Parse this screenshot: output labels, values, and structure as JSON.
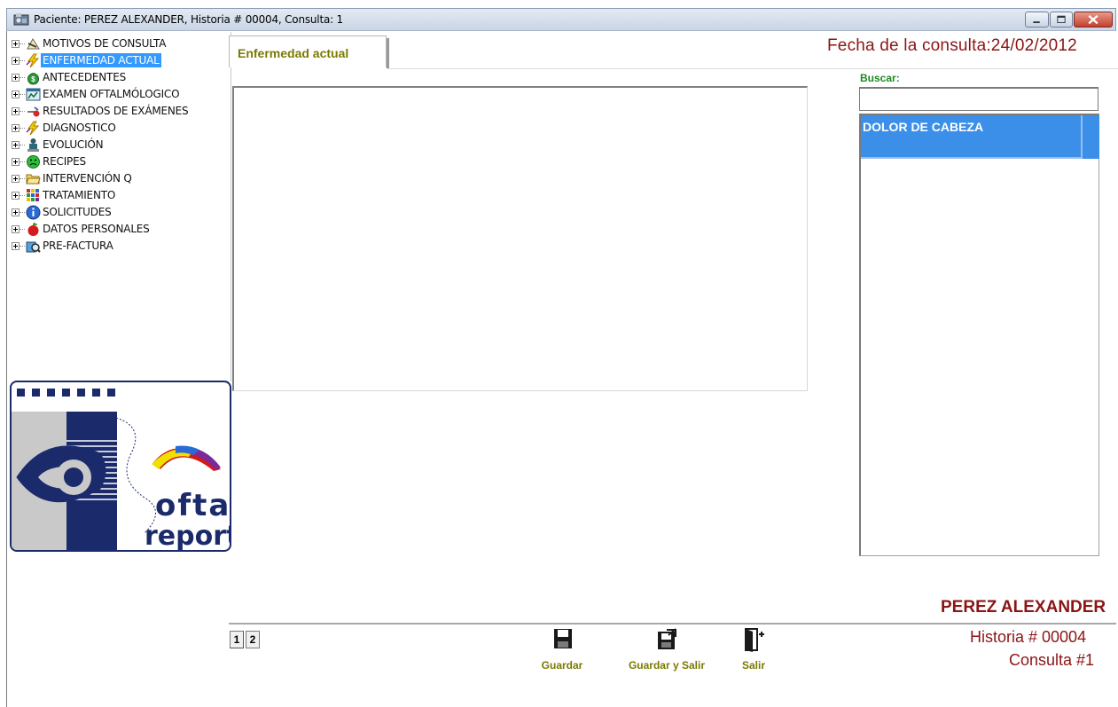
{
  "window": {
    "title": "Paciente: PEREZ ALEXANDER, Historia # 00004, Consulta: 1"
  },
  "tree": {
    "items": [
      {
        "label": "MOTIVOS DE CONSULTA",
        "icon": "pencil-ruler-icon"
      },
      {
        "label": "ENFERMEDAD ACTUAL",
        "icon": "lightning-icon",
        "selected": true
      },
      {
        "label": "ANTECEDENTES",
        "icon": "money-bag-icon"
      },
      {
        "label": "EXAMEN OFTALMÓLOGICO",
        "icon": "chart-window-icon"
      },
      {
        "label": "RESULTADOS DE EXÁMENES",
        "icon": "pin-icon"
      },
      {
        "label": "DIAGNOSTICO",
        "icon": "lightning-icon"
      },
      {
        "label": "EVOLUCIÓN",
        "icon": "person-icon"
      },
      {
        "label": "RECIPES",
        "icon": "sad-face-icon"
      },
      {
        "label": "INTERVENCIÓN Q",
        "icon": "folder-open-icon"
      },
      {
        "label": "TRATAMIENTO",
        "icon": "grid-icon"
      },
      {
        "label": "SOLICITUDES",
        "icon": "info-icon"
      },
      {
        "label": "DATOS PERSONALES",
        "icon": "apple-icon"
      },
      {
        "label": "PRE-FACTURA",
        "icon": "magnifier-icon"
      }
    ]
  },
  "logo": {
    "text_line1": "oftal",
    "text_line2": "report"
  },
  "tab": {
    "label": "Enfermedad actual"
  },
  "header": {
    "date_label": "Fecha de la consulta:24/02/2012"
  },
  "search": {
    "label": "Buscar:",
    "value": ""
  },
  "list": {
    "items": [
      "DOLOR DE CABEZA"
    ]
  },
  "patient": {
    "name": "PEREZ ALEXANDER",
    "historia": "Historia # 00004",
    "consulta": "Consulta #1"
  },
  "pages": [
    "1",
    "2"
  ],
  "actions": {
    "guardar": "Guardar",
    "guardar_salir": "Guardar y Salir",
    "salir": "Salir"
  },
  "colors": {
    "accent_red": "#8b1515",
    "accent_olive": "#7a7a00",
    "selection_blue": "#3399ff",
    "list_blue": "#3b8fe8",
    "buscar_green": "#1e8a1e"
  }
}
